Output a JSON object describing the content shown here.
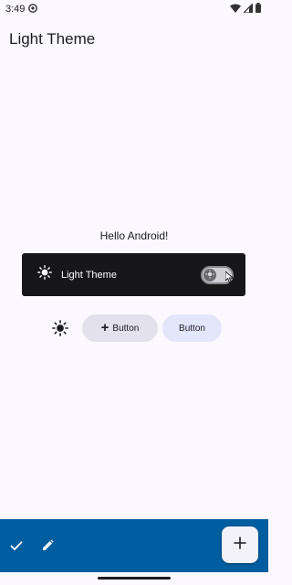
{
  "status_bar": {
    "time": "3:49",
    "icons": [
      "notification-icon",
      "wifi-icon",
      "signal-icon",
      "battery-icon"
    ]
  },
  "app_bar": {
    "title": "Light Theme"
  },
  "content": {
    "greeting": "Hello Android!",
    "theme_card": {
      "label": "Light Theme",
      "icon": "sun-icon",
      "toggle_checked": false
    },
    "buttons": {
      "tonal_label": "Button",
      "tonal_icon": "plus-icon",
      "elevated_label": "Button"
    }
  },
  "bottom_bar": {
    "actions": [
      "check-icon",
      "edit-icon"
    ],
    "fab_icon": "add-icon"
  },
  "colors": {
    "background": "#fbf8ff",
    "bottom_bar": "#005ea0",
    "card": "#17171a",
    "tonal_button": "#e2e1ec",
    "elevated_button": "#e3e7fb"
  }
}
